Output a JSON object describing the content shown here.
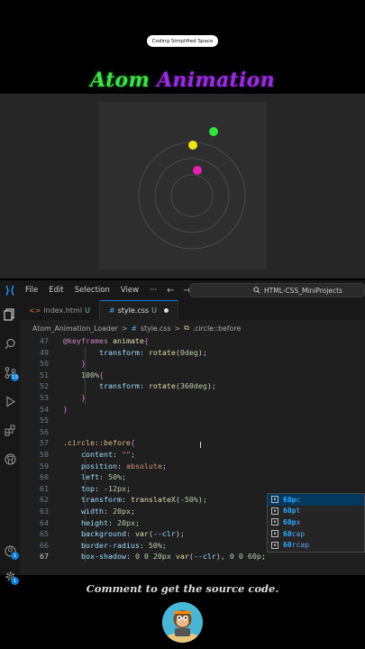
{
  "badge_text": "Coding Simplified Space",
  "title": {
    "word1": "Atom",
    "word2": "Animation"
  },
  "menu": {
    "file": "File",
    "edit": "Edit",
    "selection": "Selection",
    "view": "View",
    "more": "···",
    "back": "←",
    "forward": "→"
  },
  "command_center": "HTML-CSS_MiniProjects",
  "tabs": [
    {
      "name": "index.html",
      "status": "U"
    },
    {
      "name": "style.css",
      "status": "U"
    }
  ],
  "breadcrumb": {
    "folder": "Atom_Animation_Loader",
    "sep": ">",
    "file": "style.css",
    "symbol": ".circle::before"
  },
  "activity_badges": {
    "scm": "15",
    "accounts": "1",
    "settings": "1"
  },
  "code_lines": [
    {
      "n": "47",
      "parts": [
        [
          "t-at",
          "@keyframes "
        ],
        [
          "t-id",
          "animate"
        ],
        [
          "t-brace",
          "{"
        ]
      ]
    },
    {
      "n": "49",
      "parts": [
        [
          "t-plain",
          "        "
        ],
        [
          "t-prop",
          "transform"
        ],
        [
          "t-plain",
          ": "
        ],
        [
          "t-fn",
          "rotate"
        ],
        [
          "t-plain",
          "("
        ],
        [
          "t-num",
          "0deg"
        ],
        [
          "t-plain",
          ");"
        ]
      ]
    },
    {
      "n": "50",
      "parts": [
        [
          "t-plain",
          "    "
        ],
        [
          "t-brace",
          "}"
        ]
      ]
    },
    {
      "n": "51",
      "parts": [
        [
          "t-plain",
          "    "
        ],
        [
          "t-pct",
          "100%"
        ],
        [
          "t-brace",
          "{"
        ]
      ]
    },
    {
      "n": "52",
      "parts": [
        [
          "t-plain",
          "        "
        ],
        [
          "t-prop",
          "transform"
        ],
        [
          "t-plain",
          ": "
        ],
        [
          "t-fn",
          "rotate"
        ],
        [
          "t-plain",
          "("
        ],
        [
          "t-num",
          "360deg"
        ],
        [
          "t-plain",
          ");"
        ]
      ]
    },
    {
      "n": "53",
      "parts": [
        [
          "t-plain",
          "    "
        ],
        [
          "t-brace",
          "}"
        ]
      ]
    },
    {
      "n": "54",
      "parts": [
        [
          "t-brace",
          "}"
        ]
      ]
    },
    {
      "n": "55",
      "parts": []
    },
    {
      "n": "56",
      "parts": []
    },
    {
      "n": "57",
      "parts": [
        [
          "t-sel",
          ".circle::before"
        ],
        [
          "t-brace",
          "{"
        ]
      ]
    },
    {
      "n": "58",
      "parts": [
        [
          "t-plain",
          "    "
        ],
        [
          "t-prop",
          "content"
        ],
        [
          "t-plain",
          ": "
        ],
        [
          "t-val",
          "\"\""
        ],
        [
          "t-plain",
          ";"
        ]
      ]
    },
    {
      "n": "59",
      "parts": [
        [
          "t-plain",
          "    "
        ],
        [
          "t-prop",
          "position"
        ],
        [
          "t-plain",
          ": "
        ],
        [
          "t-val",
          "absolute"
        ],
        [
          "t-plain",
          ";"
        ]
      ]
    },
    {
      "n": "60",
      "parts": [
        [
          "t-plain",
          "    "
        ],
        [
          "t-prop",
          "left"
        ],
        [
          "t-plain",
          ": "
        ],
        [
          "t-num",
          "50%"
        ],
        [
          "t-plain",
          ";"
        ]
      ]
    },
    {
      "n": "61",
      "parts": [
        [
          "t-plain",
          "    "
        ],
        [
          "t-prop",
          "top"
        ],
        [
          "t-plain",
          ": "
        ],
        [
          "t-num",
          "-12px"
        ],
        [
          "t-plain",
          ";"
        ]
      ]
    },
    {
      "n": "62",
      "parts": [
        [
          "t-plain",
          "    "
        ],
        [
          "t-prop",
          "transform"
        ],
        [
          "t-plain",
          ": "
        ],
        [
          "t-fn",
          "translateX"
        ],
        [
          "t-plain",
          "("
        ],
        [
          "t-num",
          "-50%"
        ],
        [
          "t-plain",
          ");"
        ]
      ]
    },
    {
      "n": "63",
      "parts": [
        [
          "t-plain",
          "    "
        ],
        [
          "t-prop",
          "width"
        ],
        [
          "t-plain",
          ": "
        ],
        [
          "t-num",
          "20px"
        ],
        [
          "t-plain",
          ";"
        ]
      ]
    },
    {
      "n": "64",
      "parts": [
        [
          "t-plain",
          "    "
        ],
        [
          "t-prop",
          "height"
        ],
        [
          "t-plain",
          ": "
        ],
        [
          "t-num",
          "20px"
        ],
        [
          "t-plain",
          ";"
        ]
      ]
    },
    {
      "n": "65",
      "parts": [
        [
          "t-plain",
          "    "
        ],
        [
          "t-prop",
          "background"
        ],
        [
          "t-plain",
          ": "
        ],
        [
          "t-fn",
          "var"
        ],
        [
          "t-plain",
          "("
        ],
        [
          "t-prop",
          "--clr"
        ],
        [
          "t-plain",
          ");"
        ]
      ]
    },
    {
      "n": "66",
      "parts": [
        [
          "t-plain",
          "    "
        ],
        [
          "t-prop",
          "border-radius"
        ],
        [
          "t-plain",
          ": "
        ],
        [
          "t-num",
          "50%"
        ],
        [
          "t-plain",
          ";"
        ]
      ]
    },
    {
      "n": "67",
      "parts": [
        [
          "t-plain",
          "    "
        ],
        [
          "t-prop",
          "box-shadow"
        ],
        [
          "t-plain",
          ": "
        ],
        [
          "t-num",
          "0 0 20px "
        ],
        [
          "t-fn",
          "var"
        ],
        [
          "t-plain",
          "("
        ],
        [
          "t-prop",
          "--clr"
        ],
        [
          "t-plain",
          "), "
        ],
        [
          "t-num",
          "0 0 60p"
        ],
        [
          "t-plain",
          ";"
        ]
      ]
    }
  ],
  "current_line": "67",
  "suggestions": [
    {
      "match": "60p",
      "rest": "c"
    },
    {
      "match": "60p",
      "rest": "t"
    },
    {
      "match": "60p",
      "rest": "x"
    },
    {
      "match": "60",
      "rest": "cap"
    },
    {
      "match": "60",
      "rest": "rcap"
    }
  ],
  "footer_text": "Comment to get the source code.",
  "colors": {
    "green_dot": "#2ee53a",
    "yellow_dot": "#f0e512",
    "pink_dot": "#e91eb4",
    "accent": "#0a7bd6"
  }
}
